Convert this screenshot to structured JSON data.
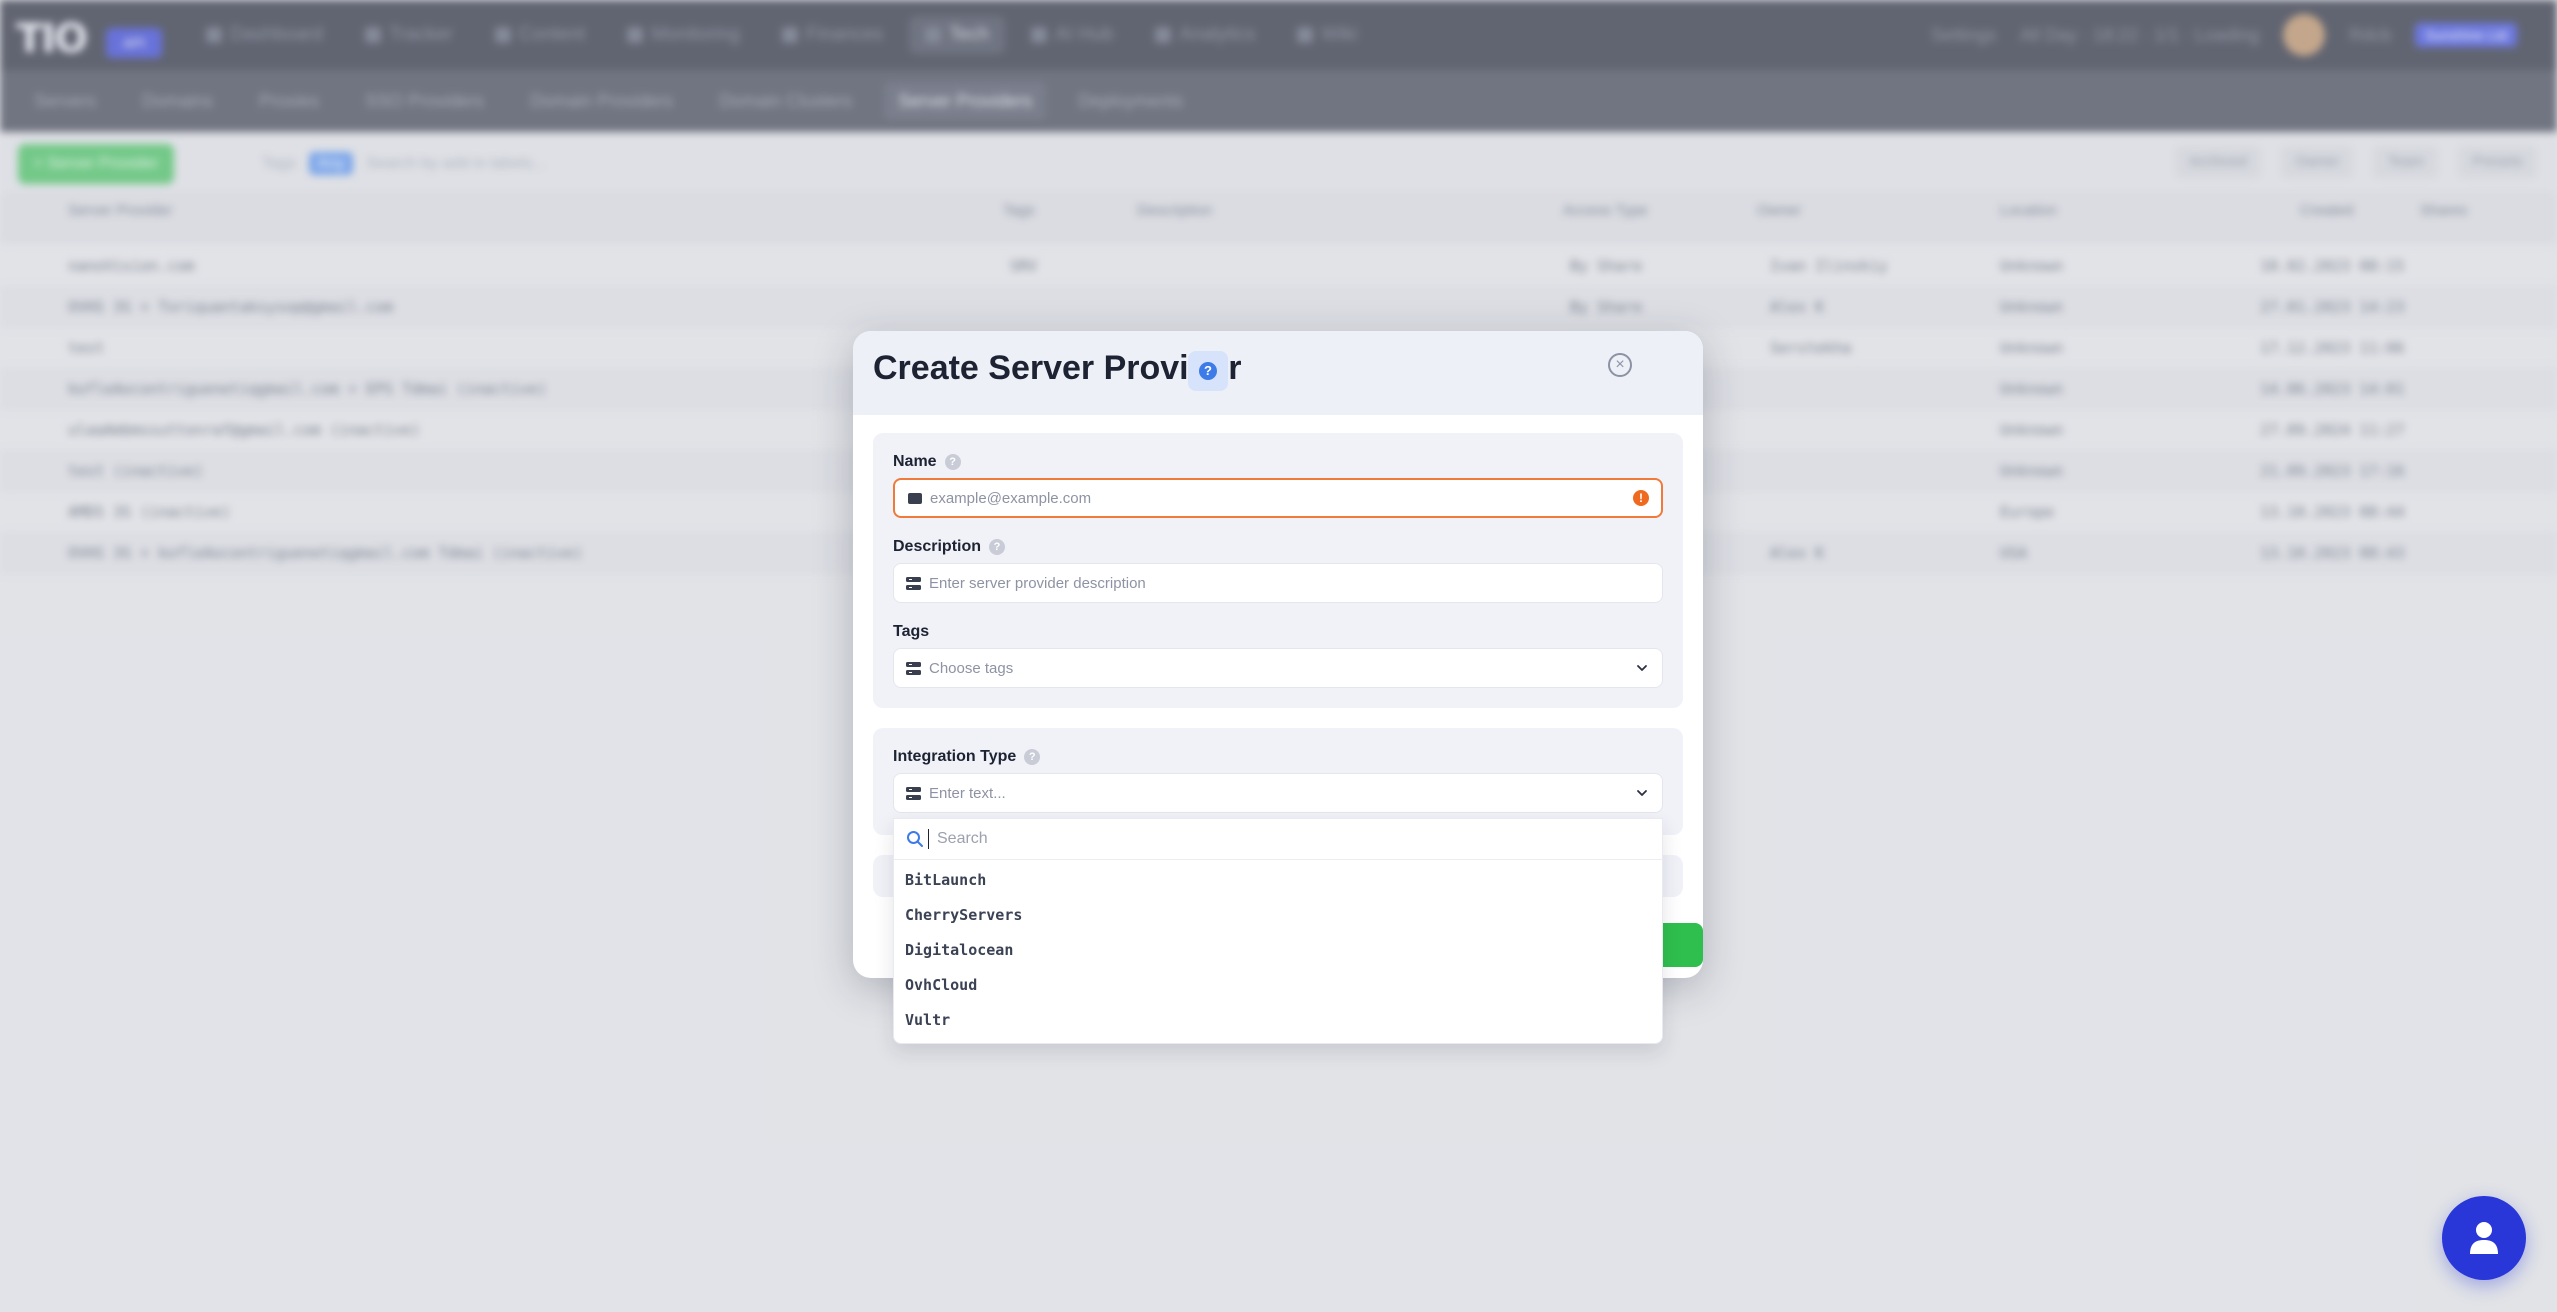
{
  "background": {
    "brand_badge": "API",
    "nav": [
      "Dashboard",
      "Tracker",
      "Content",
      "Monitoring",
      "Finances",
      "Tech",
      "AI Hub",
      "Analytics",
      "Wiki"
    ],
    "nav_active": "Tech",
    "top_right": {
      "settings": "Settings",
      "status": "All Day · 18:22 · 1/1 · Loading",
      "user": "Rdcb",
      "user_badge": "Sunshine Ltd"
    },
    "subnav": [
      "Servers",
      "Domains",
      "Proxies",
      "SSO Providers",
      "Domain Providers",
      "Domain Clusters",
      "Server Providers",
      "Deployments"
    ],
    "subnav_active": "Server Providers",
    "toolbar": {
      "add_button": "+ Server Provider",
      "tags_label": "Tags",
      "tags_chip": "Any",
      "search_placeholder": "Search by add in labels...",
      "filters": [
        "Archived",
        "Owner",
        "Team",
        "Presets"
      ]
    },
    "columns": [
      "Server Provider",
      "Tags",
      "Description",
      "Access Type",
      "Owner",
      "Location",
      "Created",
      "Shares"
    ],
    "rows": [
      {
        "name": "nanoVision.com",
        "tag": "SRV",
        "access": "By Share",
        "owner": "Ivan Ilinskiy",
        "location": "Unknown",
        "created": "10.02.2023 08:15"
      },
      {
        "name": "OVHS 3S + Toriquantaksysop@gmail.com",
        "tag": "",
        "access": "By Share",
        "owner": "Alex K",
        "location": "Unknown",
        "created": "27.01.2023 14:23"
      },
      {
        "name": "test",
        "tag": "",
        "access": "",
        "owner": "Serstekha",
        "location": "Unknown",
        "created": "17.12.2023 11:06"
      },
      {
        "name": "kofleAocontriguenetiqgmail.com + EPS Tdmai (inactive)",
        "tag": "",
        "access": "",
        "owner": "",
        "location": "Unknown",
        "created": "14.06.2023 14:01"
      },
      {
        "name": "ulaaAmbmssuttonraf@gmail.com (inactive)",
        "tag": "",
        "access": "",
        "owner": "",
        "location": "Unknown",
        "created": "27.09.2024 11:27"
      },
      {
        "name": "test (inactive)",
        "tag": "",
        "access": "",
        "owner": "",
        "location": "Unknown",
        "created": "21.09.2023 17:16"
      },
      {
        "name": "AMDS 3S (inactive)",
        "tag": "",
        "access": "",
        "owner": "",
        "location": "Europe",
        "created": "13.10.2023 08:44"
      },
      {
        "name": "OVHS 3S + kofleAocontriguenetiqgmail.com Tdmai (inactive)",
        "tag": "",
        "access": "",
        "owner": "Alex K",
        "location": "USA",
        "created": "13.10.2023 08:43"
      }
    ]
  },
  "modal": {
    "title": "Create Server Provider",
    "help_icon": "?",
    "name": {
      "label": "Name",
      "placeholder": "example@example.com",
      "warn_icon": "!"
    },
    "description": {
      "label": "Description",
      "placeholder": "Enter server provider description"
    },
    "tags": {
      "label": "Tags",
      "placeholder": "Choose tags"
    },
    "integration": {
      "label": "Integration Type",
      "placeholder": "Enter text..."
    }
  },
  "dropdown": {
    "search_placeholder": "Search",
    "options": [
      "BitLaunch",
      "CherryServers",
      "Digitalocean",
      "OvhCloud",
      "Vultr"
    ]
  },
  "colors": {
    "accent": "#3c7be8",
    "success": "#2fbf4e",
    "error": "#ef6a1f",
    "chat": "#2936d8"
  }
}
